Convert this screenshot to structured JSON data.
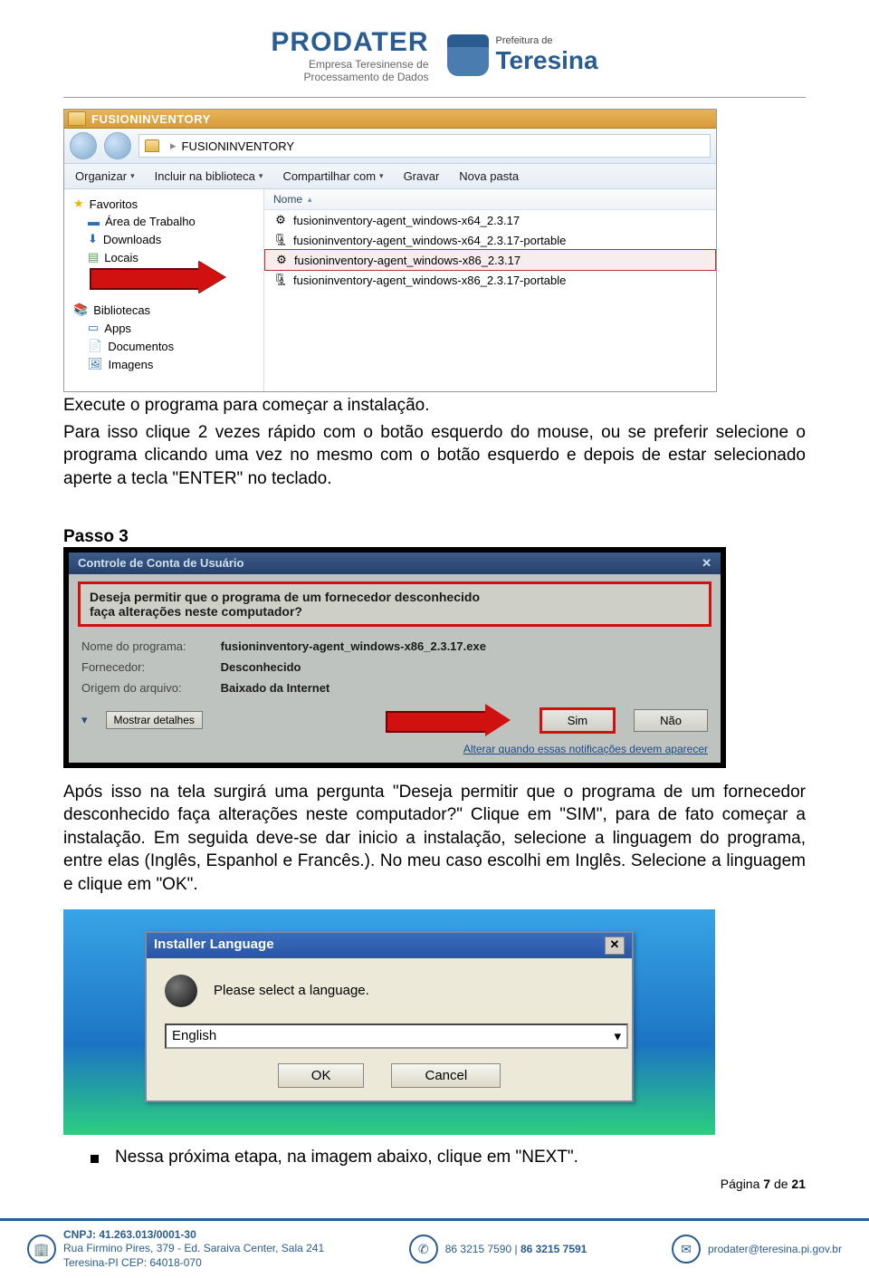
{
  "header": {
    "prodater_title": "PRODATER",
    "prodater_sub1": "Empresa Teresinense de",
    "prodater_sub2": "Processamento de Dados",
    "teresina_pref": "Prefeitura de",
    "teresina_main": "Teresina"
  },
  "explorer": {
    "titlebar": "FUSIONINVENTORY",
    "crumb_text": "FUSIONINVENTORY",
    "toolbar": {
      "organize": "Organizar",
      "include": "Incluir na biblioteca",
      "share": "Compartilhar com",
      "burn": "Gravar",
      "newfolder": "Nova pasta"
    },
    "sidepane": {
      "favorites": "Favoritos",
      "desktop": "Área de Trabalho",
      "downloads": "Downloads",
      "locals": "Locais",
      "libraries": "Bibliotecas",
      "apps": "Apps",
      "documents": "Documentos",
      "images": "Imagens"
    },
    "colhead": "Nome",
    "files": [
      "fusioninventory-agent_windows-x64_2.3.17",
      "fusioninventory-agent_windows-x64_2.3.17-portable",
      "fusioninventory-agent_windows-x86_2.3.17",
      "fusioninventory-agent_windows-x86_2.3.17-portable"
    ]
  },
  "text1": "Execute o programa para começar a instalação.",
  "text2": "Para isso clique 2 vezes rápido com o botão esquerdo do mouse, ou se preferir selecione o programa clicando uma vez no mesmo com o botão esquerdo e depois de estar selecionado aperte a tecla \"ENTER\" no teclado.",
  "passo3": "Passo 3",
  "uac": {
    "bar": "Controle de Conta de Usuário",
    "q1": "Deseja permitir que o programa de um fornecedor desconhecido",
    "q2": "faça alterações neste computador?",
    "name_lbl": "Nome do programa:",
    "name_val": "fusioninventory-agent_windows-x86_2.3.17.exe",
    "vendor_lbl": "Fornecedor:",
    "vendor_val": "Desconhecido",
    "origin_lbl": "Origem do arquivo:",
    "origin_val": "Baixado da Internet",
    "details": "Mostrar detalhes",
    "sim": "Sim",
    "nao": "Não",
    "link": "Alterar quando essas notificações devem aparecer"
  },
  "text3": "Após isso na tela surgirá uma pergunta \"Deseja permitir que o programa de um fornecedor desconhecido faça alterações neste computador?\" Clique em \"SIM\", para de fato começar a instalação. Em seguida deve-se dar inicio a instalação, selecione a linguagem do programa, entre elas (Inglês, Espanhol e Francês.). No meu caso escolhi em Inglês. Selecione a linguagem e clique em \"OK\".",
  "lang": {
    "title": "Installer Language",
    "prompt": "Please select a language.",
    "value": "English",
    "ok": "OK",
    "cancel": "Cancel"
  },
  "bullet": "Nessa próxima etapa, na imagem abaixo, clique em \"NEXT\".",
  "pagenum_label": "Página ",
  "pagenum_current": "7",
  "pagenum_sep": " de ",
  "pagenum_total": "21",
  "footer": {
    "cnpj": "CNPJ: 41.263.013/0001-30",
    "addr1": "Rua Firmino Pires, 379 - Ed. Saraiva Center, Sala 241",
    "addr2": "Teresina-PI  CEP: 64018-070",
    "phone1": "86 3215 7590",
    "phone_sep": " | ",
    "phone2": "86 3215 7591",
    "email": "prodater@teresina.pi.gov.br"
  }
}
